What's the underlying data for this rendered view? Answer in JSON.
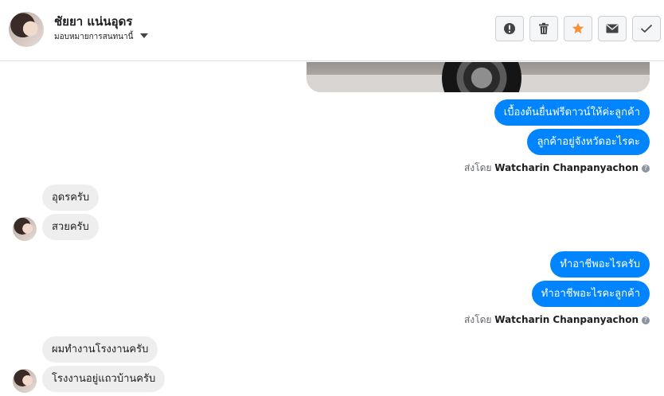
{
  "header": {
    "contact_name": "ชัยยา แน่นอุดร",
    "assign_label": "มอบหมายการสนทนานี้",
    "toolbar": {
      "spam_icon": "exclamation-circle-icon",
      "delete_icon": "trash-icon",
      "star_icon": "star-icon",
      "email_icon": "envelope-icon",
      "done_icon": "check-icon"
    }
  },
  "colors": {
    "outgoing_bubble": "#0084ff",
    "incoming_bubble": "#eeeeee",
    "star": "#f7923a"
  },
  "messages": {
    "out_group_1": [
      "เบื้องต้นยื่นฟรีดาวน์ให้ค่ะลูกค้า",
      "ลูกค้าอยู่จังหวัดอะไรคะ"
    ],
    "sent_by_1": {
      "prefix": "ส่งโดย",
      "name": "Watcharin Chanpanyachon"
    },
    "in_group_1": [
      "อุดรครับ",
      "สวยครับ"
    ],
    "out_group_2": [
      "ทำอาชีพอะไรครับ",
      "ทำอาชีพอะไรคะลูกค้า"
    ],
    "sent_by_2": {
      "prefix": "ส่งโดย",
      "name": "Watcharin Chanpanyachon"
    },
    "in_group_2": [
      "ผมทำงานโรงงานครับ",
      "โรงงานอยู่แถวบ้านครับ"
    ]
  }
}
